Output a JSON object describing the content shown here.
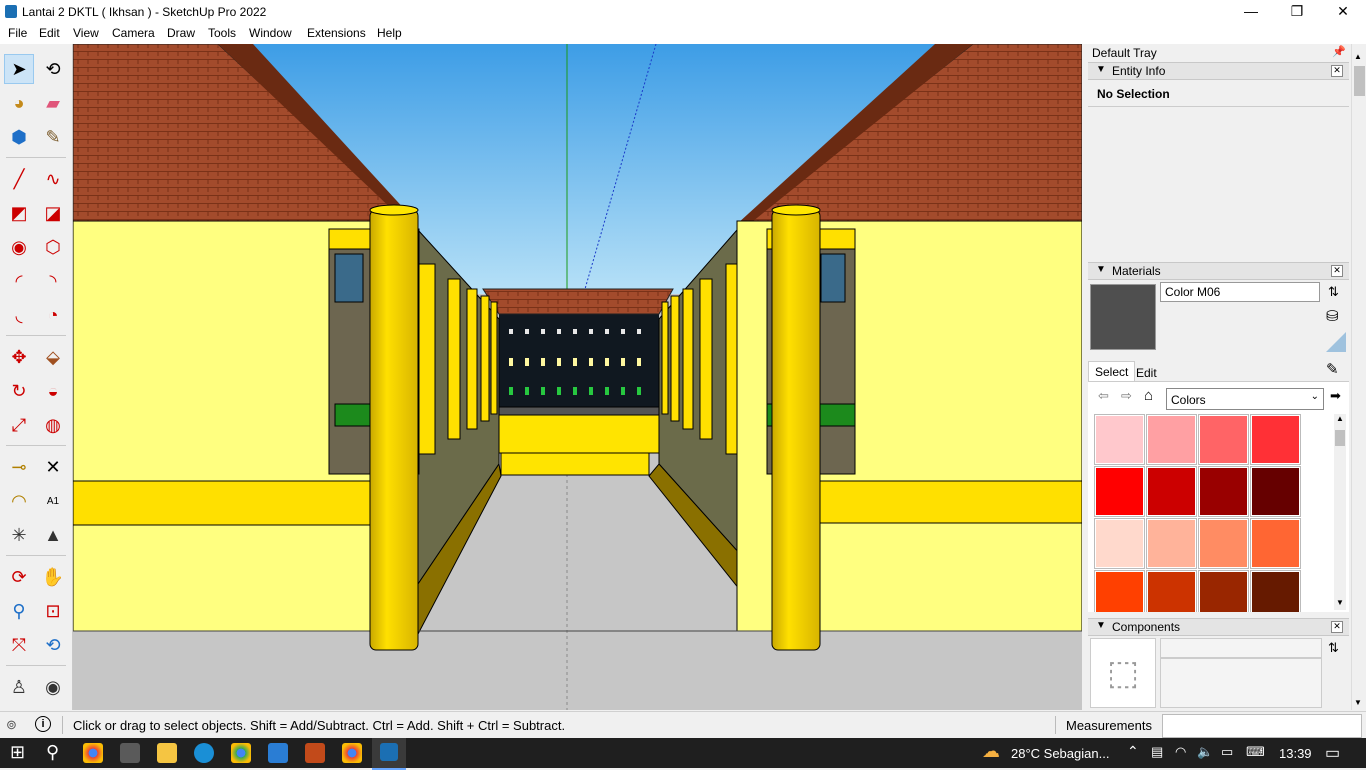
{
  "window": {
    "title": "Lantai 2 DKTL ( Ikhsan ) - SketchUp Pro 2022",
    "minimize": "—",
    "restore": "❐",
    "close": "✕"
  },
  "menu": [
    "File",
    "Edit",
    "View",
    "Camera",
    "Draw",
    "Tools",
    "Window",
    "Extensions",
    "Help"
  ],
  "tray": {
    "title": "Default Tray",
    "entity_info": {
      "header": "Entity Info",
      "selection": "No Selection"
    },
    "materials": {
      "header": "Materials",
      "material_name": "Color M06",
      "current_color": "#4f4f4f",
      "tab_select": "Select",
      "tab_edit": "Edit",
      "library": "Colors",
      "swatches": [
        "#ffc8cc",
        "#ffa0a3",
        "#ff6466",
        "#ff3036",
        "#ff0000",
        "#cc0000",
        "#990000",
        "#660000",
        "#ffd9cc",
        "#ffb39a",
        "#ff8c63",
        "#ff6633",
        "#ff4000",
        "#cc3300",
        "#992600",
        "#661a00"
      ]
    },
    "components": {
      "header": "Components"
    }
  },
  "status": {
    "hint": "Click or drag to select objects. Shift = Add/Subtract. Ctrl = Add. Shift + Ctrl = Subtract.",
    "measurements_label": "Measurements",
    "measurements_value": ""
  },
  "taskbar": {
    "weather": "28°C  Sebagian...",
    "time": "13:39"
  },
  "colors": {
    "sky_top": "#4aa3e8",
    "sky_bottom": "#a8d8f5",
    "roof": "#a04a2a",
    "wall": "#ffff80",
    "column": "#f5d000",
    "ground": "#c4c4c4"
  }
}
